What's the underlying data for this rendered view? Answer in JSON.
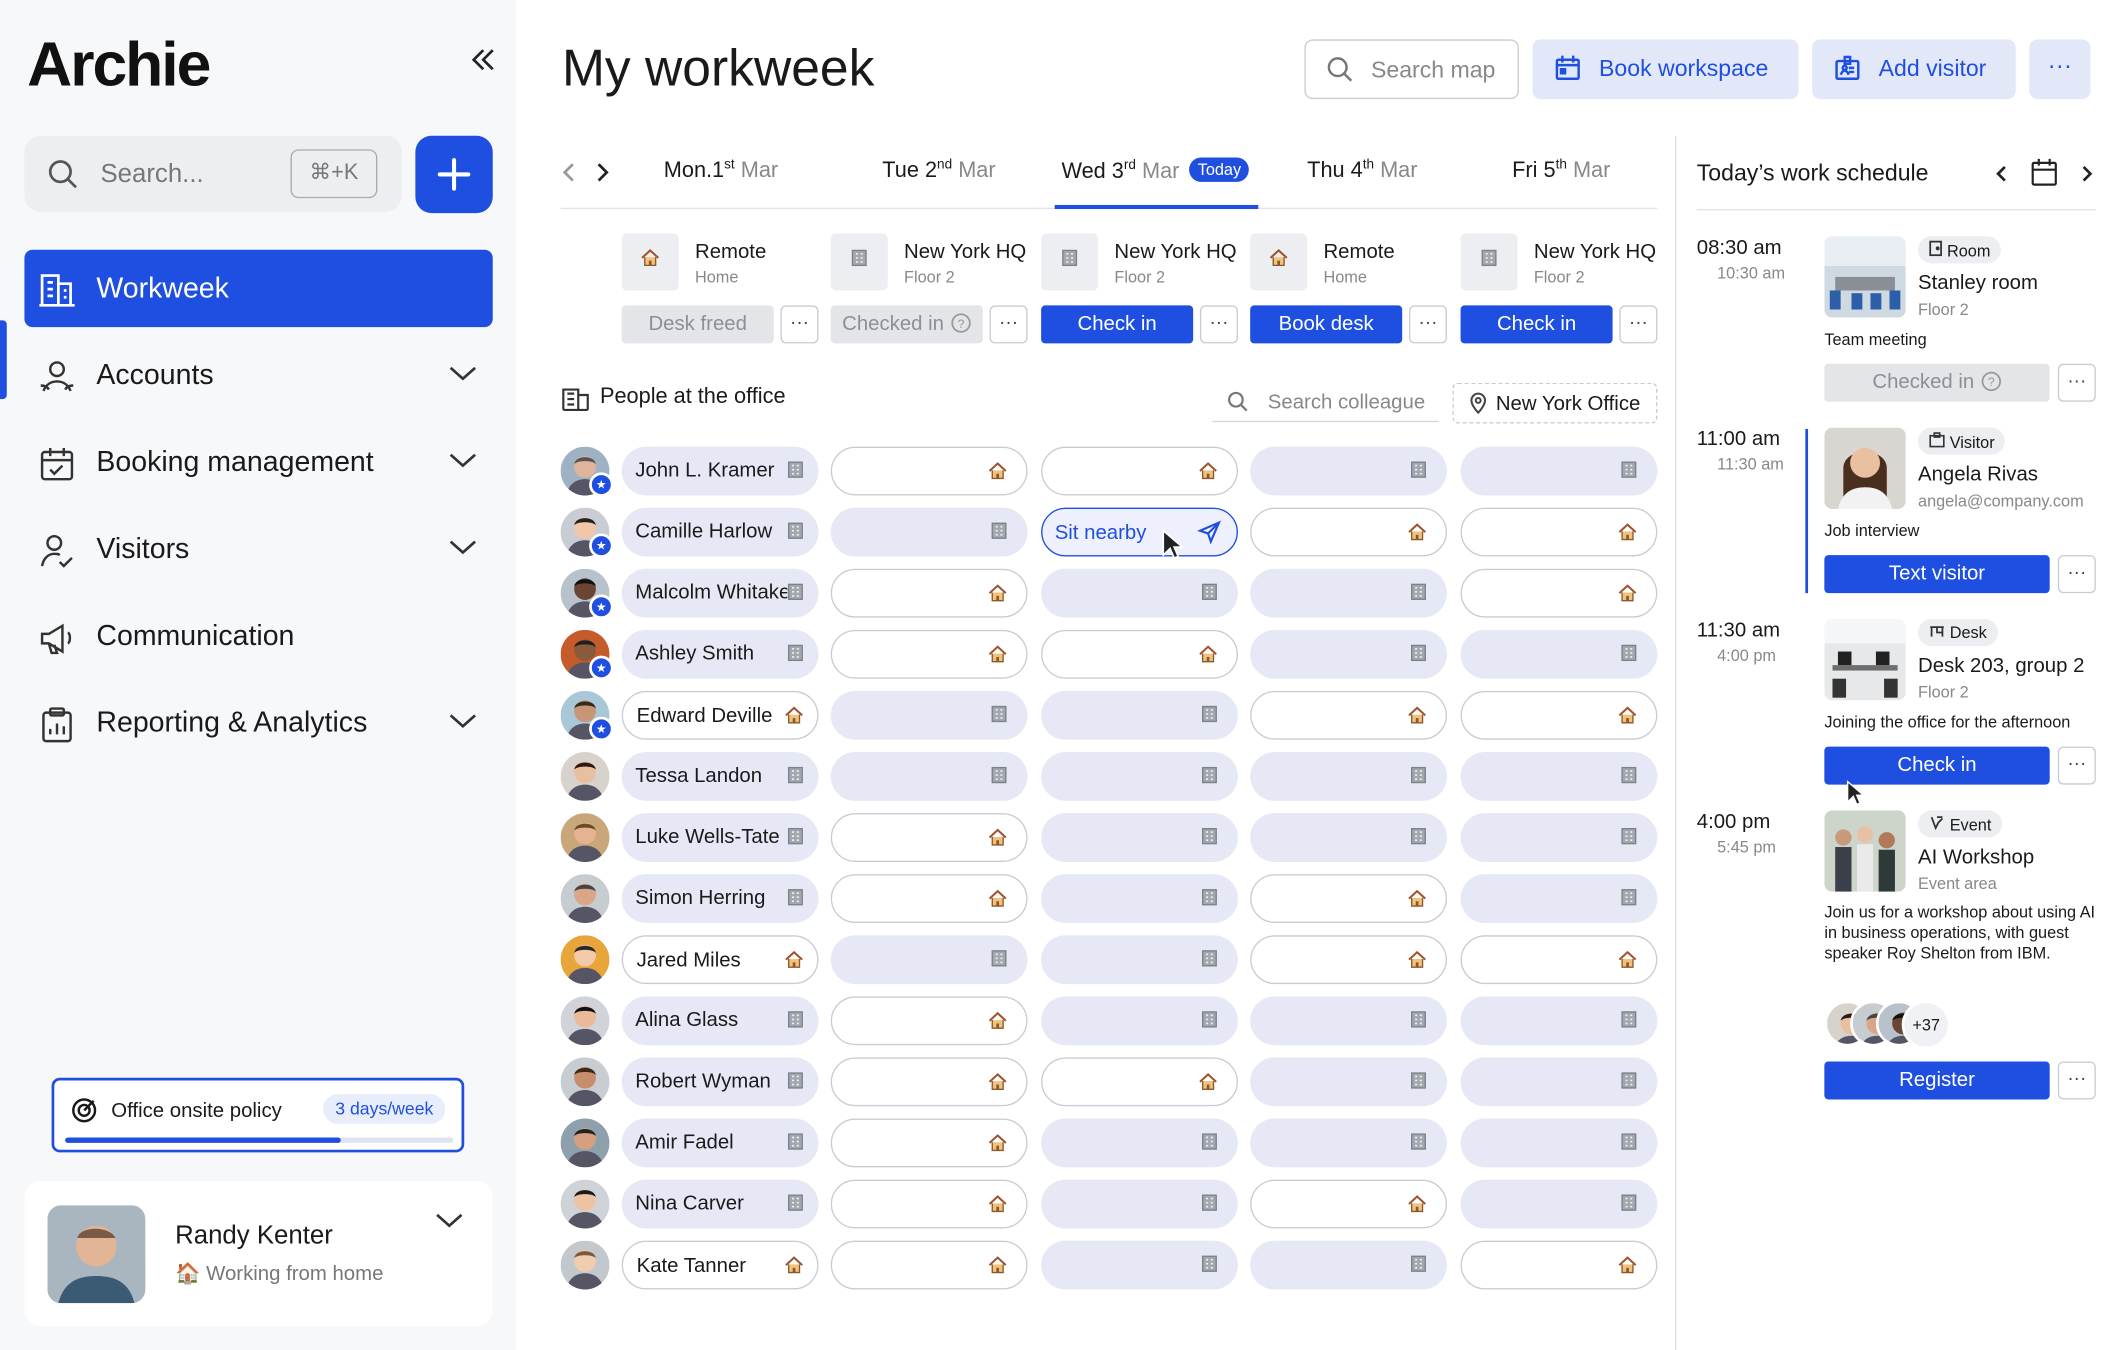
{
  "sidebar": {
    "logo": "Archie",
    "search_placeholder": "Search...",
    "shortcut": "⌘+K",
    "nav": [
      {
        "label": "Workweek",
        "icon": "building-icon",
        "active": true
      },
      {
        "label": "Accounts",
        "icon": "accounts-icon"
      },
      {
        "label": "Booking management",
        "icon": "calendar-check-icon"
      },
      {
        "label": "Visitors",
        "icon": "visitor-icon"
      },
      {
        "label": "Communication",
        "icon": "megaphone-icon"
      },
      {
        "label": "Reporting & Analytics",
        "icon": "clipboard-chart-icon"
      }
    ],
    "policy": {
      "label": "Office onsite policy",
      "value": "3 days/week",
      "progress": 0.71
    },
    "user": {
      "name": "Randy Kenter",
      "status": "Working from home"
    }
  },
  "header": {
    "title": "My workweek",
    "search_placeholder": "Search map",
    "book_workspace": "Book workspace",
    "add_visitor": "Add visitor",
    "more": "···"
  },
  "days": [
    {
      "day": "Mon.1",
      "sup": "st",
      "month": "Mar",
      "loc": "Remote",
      "sub": "Home",
      "type": "home",
      "action": "Desk freed",
      "style": "grey"
    },
    {
      "day": "Tue 2",
      "sup": "nd",
      "month": "Mar",
      "loc": "New York HQ",
      "sub": "Floor 2",
      "type": "office",
      "action": "Checked in",
      "style": "grey"
    },
    {
      "day": "Wed 3",
      "sup": "rd",
      "month": "Mar",
      "today": "Today",
      "loc": "New York HQ",
      "sub": "Floor 2",
      "type": "office",
      "action": "Check in",
      "style": "blue"
    },
    {
      "day": "Thu 4",
      "sup": "th",
      "month": "Mar",
      "loc": "Remote",
      "sub": "Home",
      "type": "home",
      "action": "Book desk",
      "style": "blue"
    },
    {
      "day": "Fri 5",
      "sup": "th",
      "month": "Mar",
      "loc": "New York HQ",
      "sub": "Floor 2",
      "type": "office",
      "action": "Check in",
      "style": "blue"
    }
  ],
  "people_section": {
    "title": "People at the office",
    "search_placeholder": "Search colleague",
    "office": "New York Office",
    "sit_nearby": "Sit nearby"
  },
  "people": [
    {
      "name": "John L. Kramer",
      "star": true,
      "own": "office",
      "week": [
        "home",
        "home",
        "office",
        "office"
      ]
    },
    {
      "name": "Camille Harlow",
      "star": true,
      "own": "office",
      "week": [
        "office",
        "nearby",
        "home",
        "home"
      ]
    },
    {
      "name": "Malcolm Whitaker",
      "star": true,
      "own": "office",
      "week": [
        "home",
        "office",
        "office",
        "home"
      ]
    },
    {
      "name": "Ashley Smith",
      "star": true,
      "own": "office",
      "week": [
        "home",
        "home",
        "office",
        "office"
      ]
    },
    {
      "name": "Edward Deville",
      "star": true,
      "own": "home",
      "week": [
        "office",
        "office",
        "home",
        "home"
      ]
    },
    {
      "name": "Tessa Landon",
      "star": false,
      "own": "office",
      "week": [
        "office",
        "office",
        "office",
        "office"
      ]
    },
    {
      "name": "Luke Wells-Tate",
      "star": false,
      "own": "office",
      "week": [
        "home",
        "office",
        "office",
        "office"
      ]
    },
    {
      "name": "Simon Herring",
      "star": false,
      "own": "office",
      "week": [
        "home",
        "office",
        "home",
        "office"
      ]
    },
    {
      "name": "Jared Miles",
      "star": false,
      "own": "home",
      "week": [
        "office",
        "office",
        "home",
        "home"
      ]
    },
    {
      "name": "Alina Glass",
      "star": false,
      "own": "office",
      "week": [
        "home",
        "office",
        "office",
        "office"
      ]
    },
    {
      "name": "Robert Wyman",
      "star": false,
      "own": "office",
      "week": [
        "home",
        "home",
        "office",
        "office"
      ]
    },
    {
      "name": "Amir Fadel",
      "star": false,
      "own": "office",
      "week": [
        "home",
        "office",
        "office",
        "office"
      ]
    },
    {
      "name": "Nina Carver",
      "star": false,
      "own": "office",
      "week": [
        "home",
        "office",
        "home",
        "office"
      ]
    },
    {
      "name": "Kate Tanner",
      "star": false,
      "own": "home",
      "week": [
        "home",
        "office",
        "office",
        "home"
      ]
    }
  ],
  "schedule": {
    "title": "Today’s work schedule",
    "items": [
      {
        "start": "08:30 am",
        "end": "10:30 am",
        "tag": "Room",
        "title": "Stanley room",
        "sub": "Floor 2",
        "desc": "Team meeting",
        "action": "Checked in",
        "style": "grey"
      },
      {
        "start": "11:00 am",
        "end": "11:30 am",
        "tag": "Visitor",
        "title": "Angela Rivas",
        "sub": "angela@company.com",
        "desc": "Job interview",
        "action": "Text visitor",
        "style": "blue"
      },
      {
        "start": "11:30 am",
        "end": "4:00 pm",
        "tag": "Desk",
        "title": "Desk 203, group 2",
        "sub": "Floor 2",
        "desc": "Joining the office for the afternoon",
        "action": "Check in",
        "style": "blue"
      },
      {
        "start": "4:00 pm",
        "end": "5:45 pm",
        "tag": "Event",
        "title": "AI Workshop",
        "sub": "Event area",
        "desc": "Join us for a workshop about using AI in business operations, with guest speaker Roy Shelton from IBM.",
        "action": "Register",
        "style": "blue",
        "attendees_more": "+37"
      }
    ]
  },
  "colors": {
    "accent": "#1e4fe0",
    "office_pill": "#e6e9f5",
    "sidebar_bg": "#f7f8fa"
  }
}
